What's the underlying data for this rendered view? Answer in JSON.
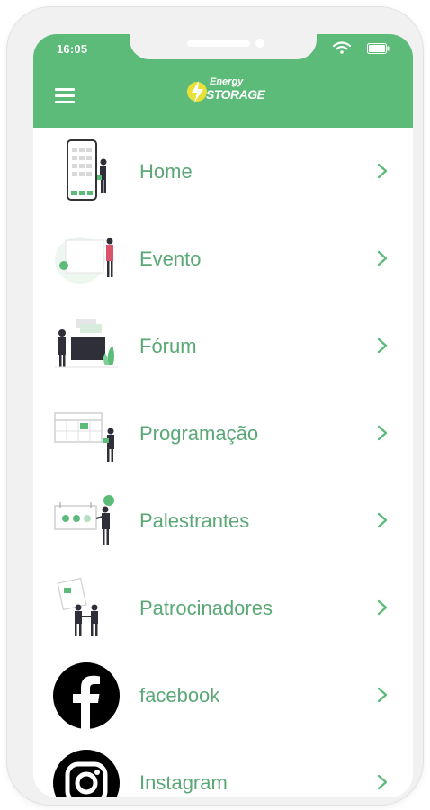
{
  "status_bar": {
    "time": "16:05"
  },
  "header": {
    "logo_line1": "Energy",
    "logo_line2": "STORAGE"
  },
  "menu": {
    "items": [
      {
        "label": "Home",
        "icon": "phone-illustration-icon"
      },
      {
        "label": "Evento",
        "icon": "presentation-illustration-icon"
      },
      {
        "label": "Fórum",
        "icon": "discussion-illustration-icon"
      },
      {
        "label": "Programação",
        "icon": "calendar-illustration-icon"
      },
      {
        "label": "Palestrantes",
        "icon": "speaker-illustration-icon"
      },
      {
        "label": "Patrocinadores",
        "icon": "sponsors-illustration-icon"
      },
      {
        "label": "facebook",
        "icon": "facebook-icon"
      },
      {
        "label": "Instagram",
        "icon": "instagram-icon"
      }
    ]
  },
  "colors": {
    "brand_green": "#5cbb78",
    "label_green": "#5aa876",
    "frame": "#f1f1f1"
  }
}
